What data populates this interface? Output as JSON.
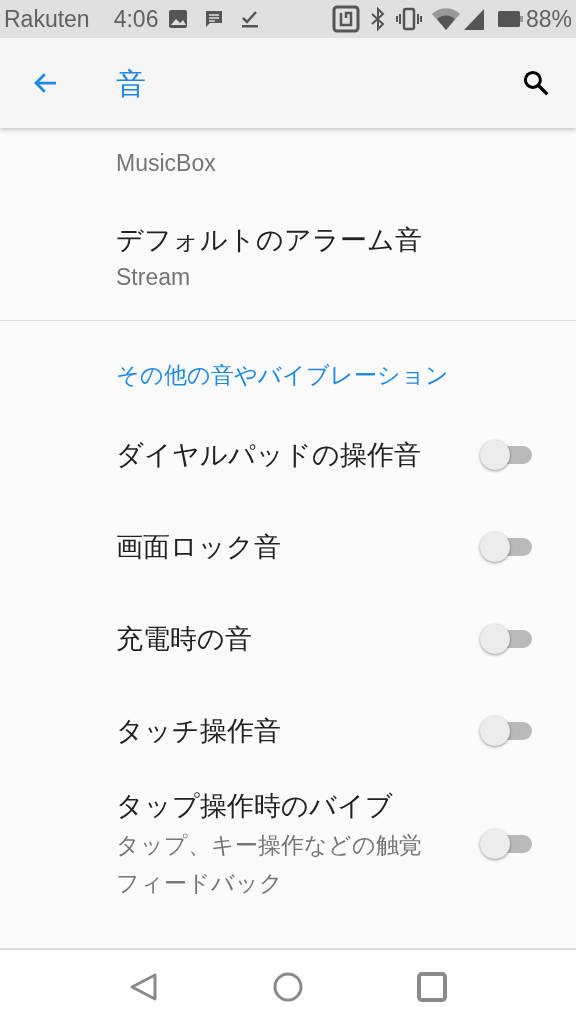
{
  "status_bar": {
    "carrier": "Rakuten",
    "time": "4:06",
    "battery": "88%"
  },
  "app_bar": {
    "title": "音"
  },
  "items": [
    {
      "subtitle": "MusicBox"
    },
    {
      "title": "デフォルトのアラーム音",
      "subtitle": "Stream"
    }
  ],
  "section": {
    "header": "その他の音やバイブレーション"
  },
  "toggles": [
    {
      "title": "ダイヤルパッドの操作音",
      "on": false
    },
    {
      "title": "画面ロック音",
      "on": false
    },
    {
      "title": "充電時の音",
      "on": false
    },
    {
      "title": "タッチ操作音",
      "on": false
    },
    {
      "title": "タップ操作時のバイブ",
      "subtitle": "タップ、キー操作などの触覚フィードバック",
      "on": false
    }
  ]
}
